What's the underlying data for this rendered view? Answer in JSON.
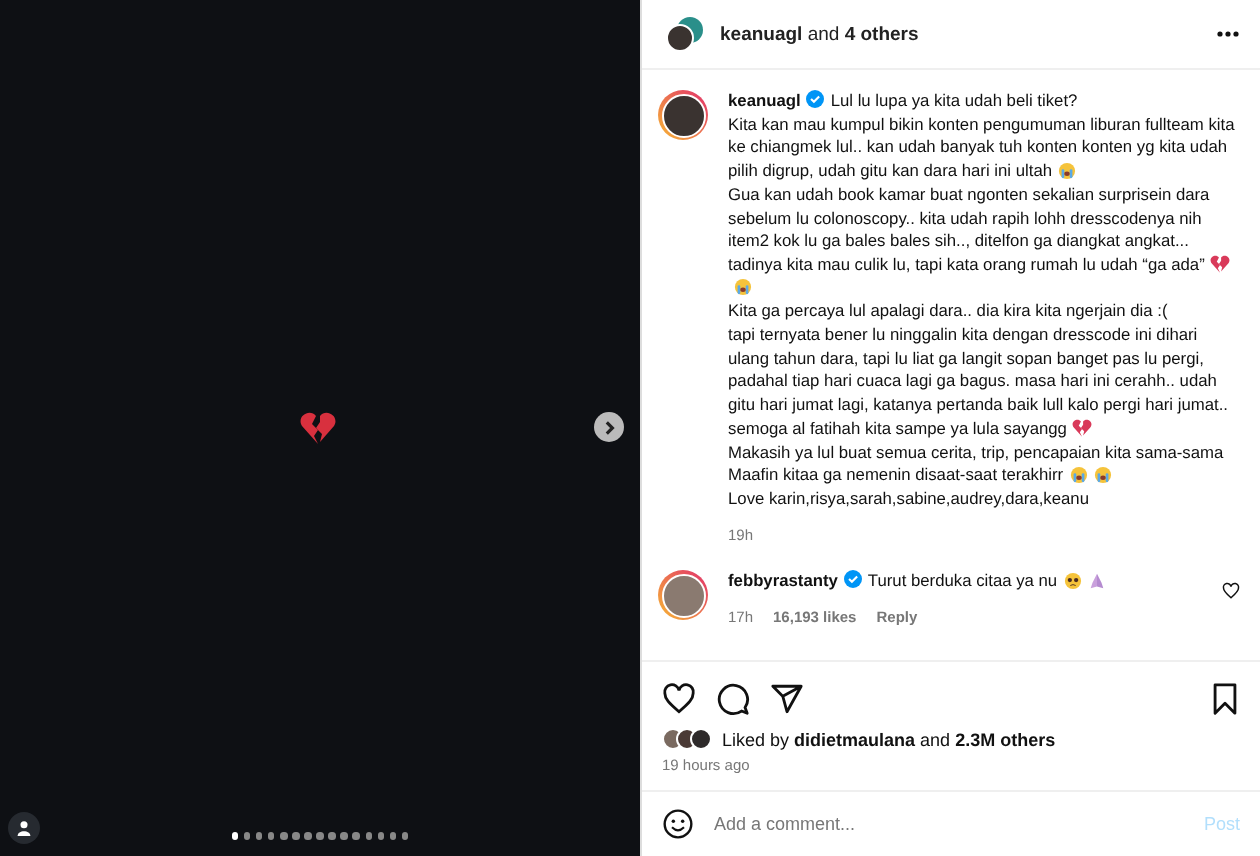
{
  "media": {
    "dots": [
      {
        "selected": true
      },
      {
        "selected": false
      },
      {
        "selected": false
      },
      {
        "selected": false
      },
      {
        "selected": false
      },
      {
        "selected": false
      },
      {
        "selected": false
      },
      {
        "selected": false
      },
      {
        "selected": false
      },
      {
        "selected": false
      },
      {
        "selected": false
      },
      {
        "selected": false
      },
      {
        "selected": false
      },
      {
        "selected": false
      },
      {
        "selected": false
      }
    ]
  },
  "header": {
    "authors": "**keanuagl** and **4 others**"
  },
  "caption": {
    "username": "keanuagl",
    "verified": true,
    "paragraphs": [
      {
        "text": "Lul lu lupa ya kita udah beli tiket?"
      },
      {
        "text": "Kita kan mau kumpul bikin konten pengumuman liburan fullteam kita ke chiangmek lul.. kan udah banyak tuh konten konten yg kita udah pilih digrup, udah gitu kan dara hari ini ultah",
        "emojis": [
          {
            "kind": "sob"
          }
        ]
      },
      {
        "text": "Gua kan udah book kamar buat ngonten sekalian surprisein dara sebelum lu colonoscopy.. kita udah rapih lohh dresscodenya nih item2 kok lu ga bales bales sih.., ditelfon ga diangkat angkat... tadinya kita mau culik lu, tapi kata orang rumah lu udah “ga ada”",
        "emojis": [
          {
            "kind": "heartbreak"
          },
          {
            "kind": "sob"
          }
        ]
      },
      {
        "text": "Kita ga percaya lul apalagi dara.. dia kira kita ngerjain dia :("
      },
      {
        "text": "tapi ternyata bener lu ninggalin kita dengan dresscode ini dihari ulang tahun dara, tapi lu liat ga langit sopan banget pas lu pergi, padahal tiap hari cuaca lagi ga bagus. masa hari ini cerahh.. udah gitu hari jumat lagi, katanya pertanda baik lull kalo pergi hari jumat.. semoga al fatihah kita sampe ya lula sayangg",
        "emojis": [
          {
            "kind": "heartbreak"
          }
        ]
      },
      {
        "text": "Makasih ya lul buat semua cerita, trip, pencapaian kita sama-sama"
      },
      {
        "text": "Maafin kitaa ga nemenin disaat-saat terakhirr",
        "emojis": [
          {
            "kind": "sob"
          },
          {
            "kind": "sob"
          }
        ]
      },
      {
        "text": "Love karin,risya,sarah,sabine,audrey,dara,keanu"
      }
    ],
    "time": "19h"
  },
  "comments": [
    {
      "username": "febbyrastanty",
      "verified": true,
      "text": "Turut berduka citaa ya nu",
      "emojis": [
        {
          "kind": "pleading"
        },
        {
          "kind": "pray"
        }
      ],
      "time": "17h",
      "likes": "16,193 likes",
      "reply": "Reply",
      "liked": false
    }
  ],
  "actions": {
    "liked": false,
    "saved": false
  },
  "likes": {
    "text": "Liked by **didietmaulana** and **2.3M others**"
  },
  "posted": "19 hours ago",
  "comment_box": {
    "placeholder": "Add a comment...",
    "post": "Post"
  }
}
